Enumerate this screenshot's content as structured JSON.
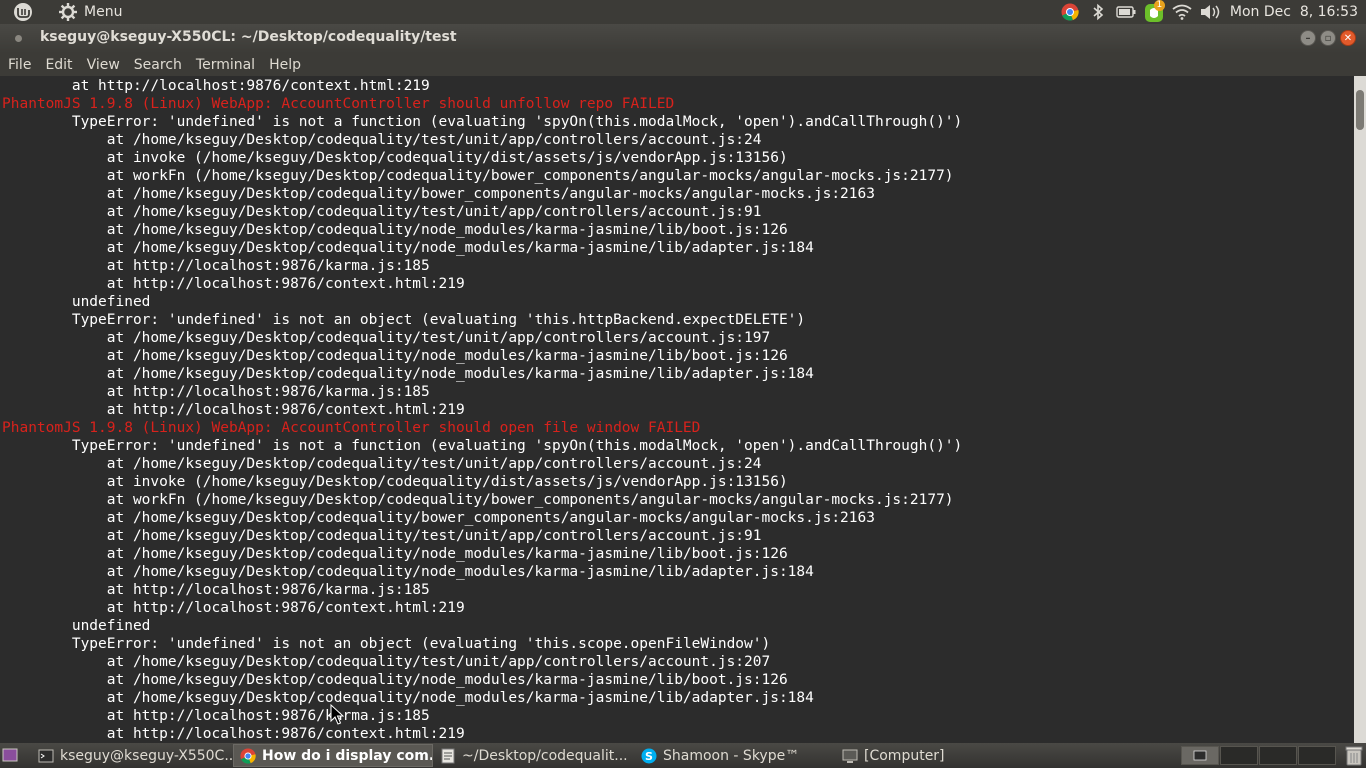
{
  "top_panel": {
    "menu_label": "Menu",
    "clock": "Mon Dec  8, 16:53",
    "notification_count": "1"
  },
  "window": {
    "title": "kseguy@kseguy-X550CL: ~/Desktop/codequality/test"
  },
  "menubar": {
    "items": [
      "File",
      "Edit",
      "View",
      "Search",
      "Terminal",
      "Help"
    ]
  },
  "terminal": {
    "lines": [
      {
        "text": "        at http://localhost:9876/context.html:219",
        "error": false
      },
      {
        "text": "PhantomJS 1.9.8 (Linux) WebApp: AccountController should unfollow repo FAILED",
        "error": true
      },
      {
        "text": "        TypeError: 'undefined' is not a function (evaluating 'spyOn(this.modalMock, 'open').andCallThrough()')",
        "error": false
      },
      {
        "text": "            at /home/kseguy/Desktop/codequality/test/unit/app/controllers/account.js:24",
        "error": false
      },
      {
        "text": "            at invoke (/home/kseguy/Desktop/codequality/dist/assets/js/vendorApp.js:13156)",
        "error": false
      },
      {
        "text": "            at workFn (/home/kseguy/Desktop/codequality/bower_components/angular-mocks/angular-mocks.js:2177)",
        "error": false
      },
      {
        "text": "            at /home/kseguy/Desktop/codequality/bower_components/angular-mocks/angular-mocks.js:2163",
        "error": false
      },
      {
        "text": "            at /home/kseguy/Desktop/codequality/test/unit/app/controllers/account.js:91",
        "error": false
      },
      {
        "text": "            at /home/kseguy/Desktop/codequality/node_modules/karma-jasmine/lib/boot.js:126",
        "error": false
      },
      {
        "text": "            at /home/kseguy/Desktop/codequality/node_modules/karma-jasmine/lib/adapter.js:184",
        "error": false
      },
      {
        "text": "            at http://localhost:9876/karma.js:185",
        "error": false
      },
      {
        "text": "            at http://localhost:9876/context.html:219",
        "error": false
      },
      {
        "text": "        undefined",
        "error": false
      },
      {
        "text": "        TypeError: 'undefined' is not an object (evaluating 'this.httpBackend.expectDELETE')",
        "error": false
      },
      {
        "text": "            at /home/kseguy/Desktop/codequality/test/unit/app/controllers/account.js:197",
        "error": false
      },
      {
        "text": "            at /home/kseguy/Desktop/codequality/node_modules/karma-jasmine/lib/boot.js:126",
        "error": false
      },
      {
        "text": "            at /home/kseguy/Desktop/codequality/node_modules/karma-jasmine/lib/adapter.js:184",
        "error": false
      },
      {
        "text": "            at http://localhost:9876/karma.js:185",
        "error": false
      },
      {
        "text": "            at http://localhost:9876/context.html:219",
        "error": false
      },
      {
        "text": "PhantomJS 1.9.8 (Linux) WebApp: AccountController should open file window FAILED",
        "error": true
      },
      {
        "text": "        TypeError: 'undefined' is not a function (evaluating 'spyOn(this.modalMock, 'open').andCallThrough()')",
        "error": false
      },
      {
        "text": "            at /home/kseguy/Desktop/codequality/test/unit/app/controllers/account.js:24",
        "error": false
      },
      {
        "text": "            at invoke (/home/kseguy/Desktop/codequality/dist/assets/js/vendorApp.js:13156)",
        "error": false
      },
      {
        "text": "            at workFn (/home/kseguy/Desktop/codequality/bower_components/angular-mocks/angular-mocks.js:2177)",
        "error": false
      },
      {
        "text": "            at /home/kseguy/Desktop/codequality/bower_components/angular-mocks/angular-mocks.js:2163",
        "error": false
      },
      {
        "text": "            at /home/kseguy/Desktop/codequality/test/unit/app/controllers/account.js:91",
        "error": false
      },
      {
        "text": "            at /home/kseguy/Desktop/codequality/node_modules/karma-jasmine/lib/boot.js:126",
        "error": false
      },
      {
        "text": "            at /home/kseguy/Desktop/codequality/node_modules/karma-jasmine/lib/adapter.js:184",
        "error": false
      },
      {
        "text": "            at http://localhost:9876/karma.js:185",
        "error": false
      },
      {
        "text": "            at http://localhost:9876/context.html:219",
        "error": false
      },
      {
        "text": "        undefined",
        "error": false
      },
      {
        "text": "        TypeError: 'undefined' is not an object (evaluating 'this.scope.openFileWindow')",
        "error": false
      },
      {
        "text": "            at /home/kseguy/Desktop/codequality/test/unit/app/controllers/account.js:207",
        "error": false
      },
      {
        "text": "            at /home/kseguy/Desktop/codequality/node_modules/karma-jasmine/lib/boot.js:126",
        "error": false
      },
      {
        "text": "            at /home/kseguy/Desktop/codequality/node_modules/karma-jasmine/lib/adapter.js:184",
        "error": false
      },
      {
        "text": "            at http://localhost:9876/karma.js:185",
        "error": false
      },
      {
        "text": "            at http://localhost:9876/context.html:219",
        "error": false
      }
    ]
  },
  "taskbar": {
    "tasks": [
      {
        "label": "kseguy@kseguy-X550C...",
        "icon": "terminal-icon",
        "active": false
      },
      {
        "label": "How do i display com...",
        "icon": "chrome-icon",
        "active": true
      },
      {
        "label": "~/Desktop/codequalit...",
        "icon": "text-editor-icon",
        "active": false
      },
      {
        "label": "Shamoon - Skype™",
        "icon": "skype-icon",
        "active": false
      },
      {
        "label": "[Computer]",
        "icon": "file-manager-icon",
        "active": false
      }
    ]
  },
  "colors": {
    "panel_bg": "#3c3b37",
    "terminal_bg": "#2c2c2c",
    "terminal_fg": "#ffffff",
    "error_fg": "#d8221c",
    "close_button": "#e25a2b"
  }
}
